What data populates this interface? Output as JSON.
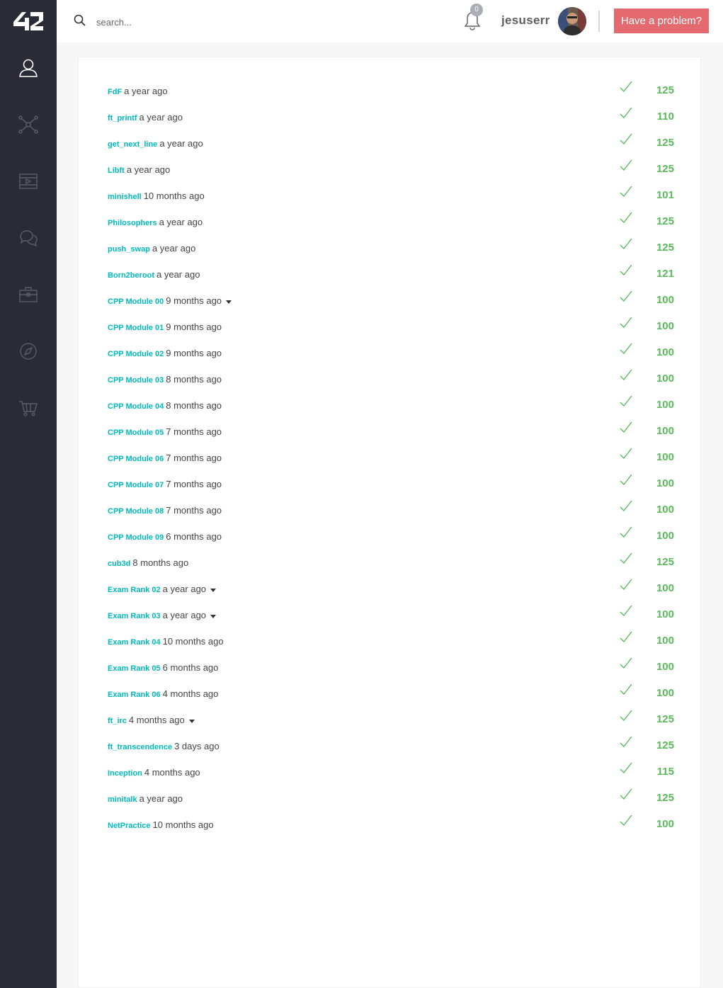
{
  "app": {
    "logo_text": "42"
  },
  "sidebar": {
    "items": [
      {
        "icon": "user-icon"
      },
      {
        "icon": "network-icon"
      },
      {
        "icon": "video-icon"
      },
      {
        "icon": "chat-icon"
      },
      {
        "icon": "briefcase-icon"
      },
      {
        "icon": "compass-icon"
      },
      {
        "icon": "cart-icon"
      }
    ]
  },
  "header": {
    "search_placeholder": "search...",
    "notifications_count": "0",
    "username": "jesuserr",
    "problem_label": "Have a problem?"
  },
  "colors": {
    "sidebar_bg": "#292c36",
    "link": "#00babc",
    "success": "#5cb85c",
    "problem_button": "#e46a6f"
  },
  "projects": [
    {
      "name": "FdF",
      "date": "a year ago",
      "score": "125",
      "dropdown": false
    },
    {
      "name": "ft_printf",
      "date": "a year ago",
      "score": "110",
      "dropdown": false
    },
    {
      "name": "get_next_line",
      "date": "a year ago",
      "score": "125",
      "dropdown": false
    },
    {
      "name": "Libft",
      "date": "a year ago",
      "score": "125",
      "dropdown": false
    },
    {
      "name": "minishell",
      "date": "10 months ago",
      "score": "101",
      "dropdown": false
    },
    {
      "name": "Philosophers",
      "date": "a year ago",
      "score": "125",
      "dropdown": false
    },
    {
      "name": "push_swap",
      "date": "a year ago",
      "score": "125",
      "dropdown": false
    },
    {
      "name": "Born2beroot",
      "date": "a year ago",
      "score": "121",
      "dropdown": false
    },
    {
      "name": "CPP Module 00",
      "date": "9 months ago",
      "score": "100",
      "dropdown": true
    },
    {
      "name": "CPP Module 01",
      "date": "9 months ago",
      "score": "100",
      "dropdown": false
    },
    {
      "name": "CPP Module 02",
      "date": "9 months ago",
      "score": "100",
      "dropdown": false
    },
    {
      "name": "CPP Module 03",
      "date": "8 months ago",
      "score": "100",
      "dropdown": false
    },
    {
      "name": "CPP Module 04",
      "date": "8 months ago",
      "score": "100",
      "dropdown": false
    },
    {
      "name": "CPP Module 05",
      "date": "7 months ago",
      "score": "100",
      "dropdown": false
    },
    {
      "name": "CPP Module 06",
      "date": "7 months ago",
      "score": "100",
      "dropdown": false
    },
    {
      "name": "CPP Module 07",
      "date": "7 months ago",
      "score": "100",
      "dropdown": false
    },
    {
      "name": "CPP Module 08",
      "date": "7 months ago",
      "score": "100",
      "dropdown": false
    },
    {
      "name": "CPP Module 09",
      "date": "6 months ago",
      "score": "100",
      "dropdown": false
    },
    {
      "name": "cub3d",
      "date": "8 months ago",
      "score": "125",
      "dropdown": false
    },
    {
      "name": "Exam Rank 02",
      "date": "a year ago",
      "score": "100",
      "dropdown": true
    },
    {
      "name": "Exam Rank 03",
      "date": "a year ago",
      "score": "100",
      "dropdown": true
    },
    {
      "name": "Exam Rank 04",
      "date": "10 months ago",
      "score": "100",
      "dropdown": false
    },
    {
      "name": "Exam Rank 05",
      "date": "6 months ago",
      "score": "100",
      "dropdown": false
    },
    {
      "name": "Exam Rank 06",
      "date": "4 months ago",
      "score": "100",
      "dropdown": false
    },
    {
      "name": "ft_irc",
      "date": "4 months ago",
      "score": "125",
      "dropdown": true
    },
    {
      "name": "ft_transcendence",
      "date": "3 days ago",
      "score": "125",
      "dropdown": false
    },
    {
      "name": "Inception",
      "date": "4 months ago",
      "score": "115",
      "dropdown": false
    },
    {
      "name": "minitalk",
      "date": "a year ago",
      "score": "125",
      "dropdown": false
    },
    {
      "name": "NetPractice",
      "date": "10 months ago",
      "score": "100",
      "dropdown": false
    }
  ]
}
